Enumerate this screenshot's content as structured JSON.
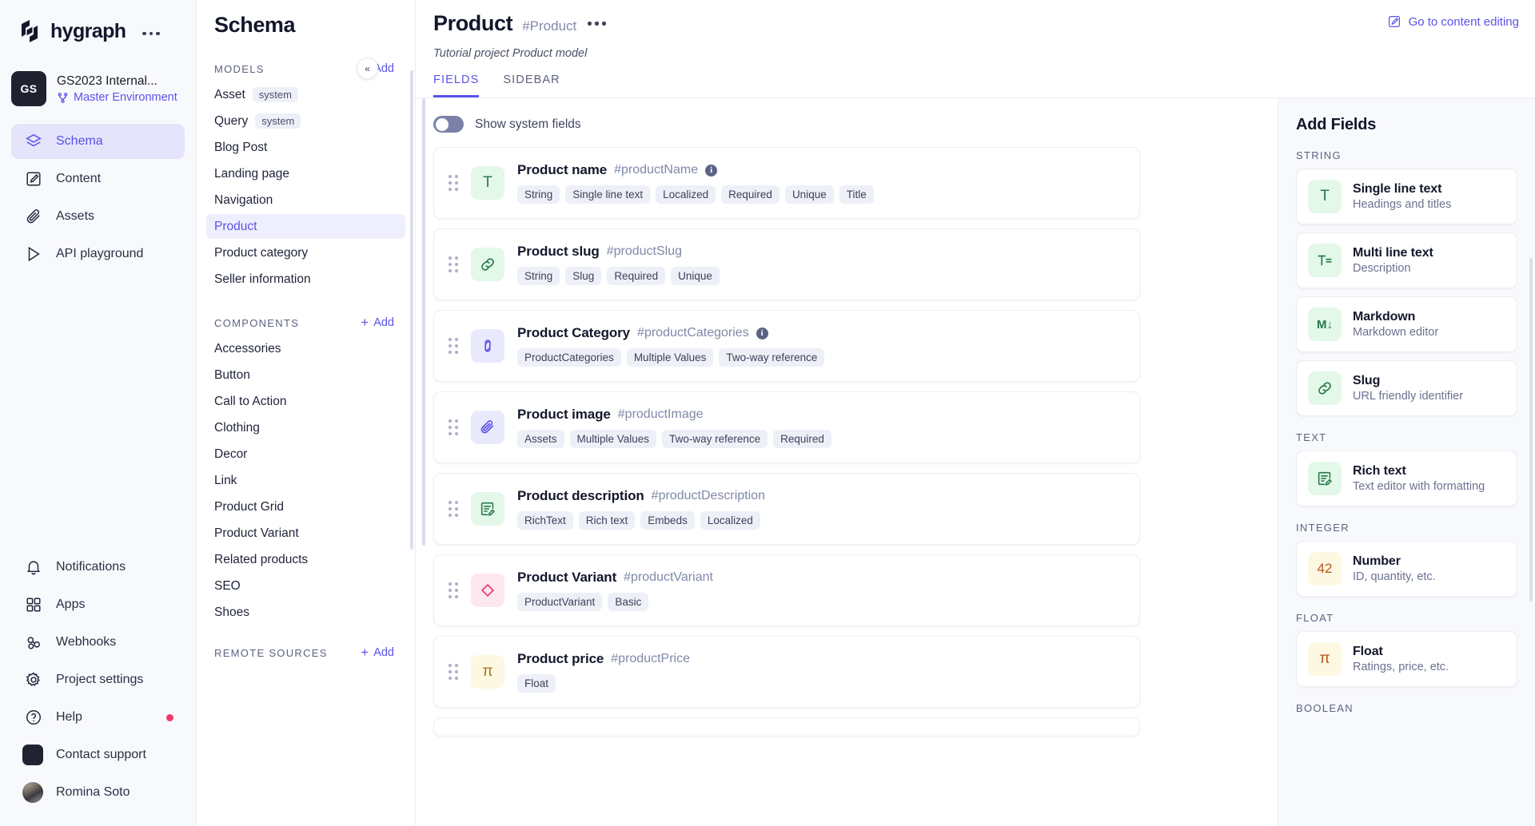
{
  "brand": {
    "name": "hygraph"
  },
  "project": {
    "initials": "GS",
    "name": "GS2023 Internal...",
    "environment": "Master Environment"
  },
  "nav": {
    "primary": [
      {
        "label": "Schema",
        "icon": "layers-icon",
        "active": true
      },
      {
        "label": "Content",
        "icon": "edit-square-icon",
        "active": false
      },
      {
        "label": "Assets",
        "icon": "paperclip-icon",
        "active": false
      },
      {
        "label": "API playground",
        "icon": "play-icon",
        "active": false
      }
    ],
    "secondary": [
      {
        "label": "Notifications",
        "icon": "bell-icon"
      },
      {
        "label": "Apps",
        "icon": "grid-icon"
      },
      {
        "label": "Webhooks",
        "icon": "webhook-icon"
      },
      {
        "label": "Project settings",
        "icon": "gear-icon"
      },
      {
        "label": "Help",
        "icon": "question-circle-icon",
        "badge": true
      },
      {
        "label": "Contact support",
        "icon": "chat-icon"
      },
      {
        "label": "Romina Soto",
        "icon": "avatar"
      }
    ]
  },
  "schema_panel": {
    "title": "Schema",
    "sections": [
      {
        "label": "MODELS",
        "add_label": "Add",
        "items": [
          {
            "label": "Asset",
            "chip": "system",
            "active": false
          },
          {
            "label": "Query",
            "chip": "system",
            "active": false
          },
          {
            "label": "Blog Post",
            "chip": "",
            "active": false
          },
          {
            "label": "Landing page",
            "chip": "",
            "active": false
          },
          {
            "label": "Navigation",
            "chip": "",
            "active": false
          },
          {
            "label": "Product",
            "chip": "",
            "active": true
          },
          {
            "label": "Product category",
            "chip": "",
            "active": false
          },
          {
            "label": "Seller information",
            "chip": "",
            "active": false
          }
        ]
      },
      {
        "label": "COMPONENTS",
        "add_label": "Add",
        "items": [
          {
            "label": "Accessories",
            "chip": "",
            "active": false
          },
          {
            "label": "Button",
            "chip": "",
            "active": false
          },
          {
            "label": "Call to Action",
            "chip": "",
            "active": false
          },
          {
            "label": "Clothing",
            "chip": "",
            "active": false
          },
          {
            "label": "Decor",
            "chip": "",
            "active": false
          },
          {
            "label": "Link",
            "chip": "",
            "active": false
          },
          {
            "label": "Product Grid",
            "chip": "",
            "active": false
          },
          {
            "label": "Product Variant",
            "chip": "",
            "active": false
          },
          {
            "label": "Related products",
            "chip": "",
            "active": false
          },
          {
            "label": "SEO",
            "chip": "",
            "active": false
          },
          {
            "label": "Shoes",
            "chip": "",
            "active": false
          }
        ]
      },
      {
        "label": "REMOTE SOURCES",
        "add_label": "Add",
        "items": []
      }
    ]
  },
  "collapse_button": {
    "glyph": "«"
  },
  "header": {
    "title": "Product",
    "api_id": "#Product",
    "subtitle": "Tutorial project Product model",
    "go_to_content": "Go to content editing",
    "tabs": [
      {
        "label": "FIELDS",
        "active": true
      },
      {
        "label": "SIDEBAR",
        "active": false
      }
    ]
  },
  "system_fields_toggle": {
    "label": "Show system fields",
    "on": false
  },
  "fields": [
    {
      "name": "Product name",
      "api_id": "#productName",
      "info": true,
      "icon": "text-icon",
      "icon_glyph": "T",
      "icon_color": "green",
      "tags": [
        "String",
        "Single line text",
        "Localized",
        "Required",
        "Unique",
        "Title"
      ]
    },
    {
      "name": "Product slug",
      "api_id": "#productSlug",
      "info": false,
      "icon": "link-icon",
      "icon_glyph": "",
      "icon_color": "green",
      "tags": [
        "String",
        "Slug",
        "Required",
        "Unique"
      ]
    },
    {
      "name": "Product Category",
      "api_id": "#productCategories",
      "info": true,
      "icon": "reference-link-icon",
      "icon_glyph": "",
      "icon_color": "indigo",
      "tags": [
        "ProductCategories",
        "Multiple Values",
        "Two-way reference"
      ]
    },
    {
      "name": "Product image",
      "api_id": "#productImage",
      "info": false,
      "icon": "paperclip-icon",
      "icon_glyph": "",
      "icon_color": "indigo",
      "tags": [
        "Assets",
        "Multiple Values",
        "Two-way reference",
        "Required"
      ]
    },
    {
      "name": "Product description",
      "api_id": "#productDescription",
      "info": false,
      "icon": "rich-text-icon",
      "icon_glyph": "",
      "icon_color": "green",
      "tags": [
        "RichText",
        "Rich text",
        "Embeds",
        "Localized"
      ]
    },
    {
      "name": "Product Variant",
      "api_id": "#productVariant",
      "info": false,
      "icon": "diamond-icon",
      "icon_glyph": "",
      "icon_color": "pink",
      "tags": [
        "ProductVariant",
        "Basic"
      ]
    },
    {
      "name": "Product price",
      "api_id": "#productPrice",
      "info": false,
      "icon": "pi-icon",
      "icon_glyph": "π",
      "icon_color": "yellow",
      "tags": [
        "Float"
      ]
    }
  ],
  "add_fields": {
    "title": "Add Fields",
    "groups": [
      {
        "label": "STRING",
        "items": [
          {
            "name": "Single line text",
            "desc": "Headings and titles",
            "icon": "text-icon",
            "glyph": "T",
            "color": "green"
          },
          {
            "name": "Multi line text",
            "desc": "Description",
            "icon": "multiline-text-icon",
            "glyph": "",
            "color": "green"
          },
          {
            "name": "Markdown",
            "desc": "Markdown editor",
            "icon": "markdown-icon",
            "glyph": "M↓",
            "color": "green"
          },
          {
            "name": "Slug",
            "desc": "URL friendly identifier",
            "icon": "link-icon",
            "glyph": "",
            "color": "green"
          }
        ]
      },
      {
        "label": "TEXT",
        "items": [
          {
            "name": "Rich text",
            "desc": "Text editor with formatting",
            "icon": "rich-text-icon",
            "glyph": "",
            "color": "green"
          }
        ]
      },
      {
        "label": "INTEGER",
        "items": [
          {
            "name": "Number",
            "desc": "ID, quantity, etc.",
            "icon": "number-icon",
            "glyph": "42",
            "color": "yellow"
          }
        ]
      },
      {
        "label": "FLOAT",
        "items": [
          {
            "name": "Float",
            "desc": "Ratings, price, etc.",
            "icon": "pi-icon",
            "glyph": "π",
            "color": "yellow"
          }
        ]
      },
      {
        "label": "BOOLEAN",
        "items": []
      }
    ]
  },
  "colors": {
    "accent": "#5b52e8",
    "dark": "#13172b",
    "muted": "#6b7290",
    "badge": "#f0386b"
  }
}
